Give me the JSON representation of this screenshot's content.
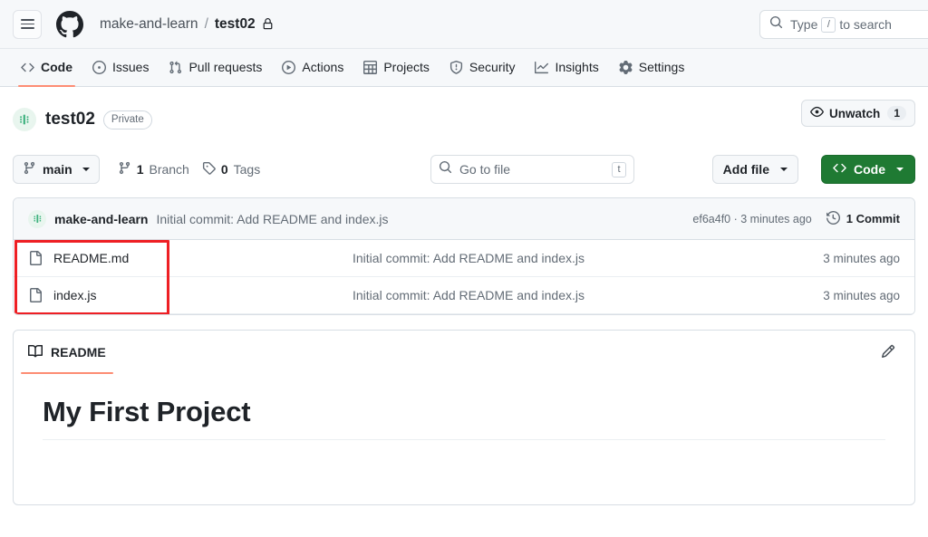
{
  "header": {
    "menu_label": "Open global navigation menu",
    "logo_name": "github-logo",
    "breadcrumb": {
      "owner": "make-and-learn",
      "separator": "/",
      "repo": "test02",
      "lock_icon": "lock-icon"
    },
    "search": {
      "placeholder_prefix": "Type",
      "key_badge": "/",
      "placeholder_suffix": "to search",
      "icon": "search-icon"
    }
  },
  "repo_nav": {
    "items": [
      {
        "label": "Code",
        "icon": "code-icon",
        "active": true
      },
      {
        "label": "Issues",
        "icon": "issue-opened-icon",
        "active": false
      },
      {
        "label": "Pull requests",
        "icon": "git-pull-request-icon",
        "active": false
      },
      {
        "label": "Actions",
        "icon": "play-icon",
        "active": false
      },
      {
        "label": "Projects",
        "icon": "table-icon",
        "active": false
      },
      {
        "label": "Security",
        "icon": "shield-icon",
        "active": false
      },
      {
        "label": "Insights",
        "icon": "graph-icon",
        "active": false
      },
      {
        "label": "Settings",
        "icon": "gear-icon",
        "active": false
      }
    ]
  },
  "repo_header": {
    "avatar": "repo-owner-avatar",
    "title": "test02",
    "visibility": "Private",
    "watch": {
      "label": "Unwatch",
      "count": "1",
      "icon": "eye-icon"
    }
  },
  "file_toolbar": {
    "branch": {
      "name": "main",
      "icon": "git-branch-icon"
    },
    "branch_count": {
      "value": "1",
      "label": "Branch",
      "icon": "git-branch-icon"
    },
    "tag_count": {
      "value": "0",
      "label": "Tags",
      "icon": "tag-icon"
    },
    "go_to_file": {
      "placeholder": "Go to file",
      "key_badge": "t",
      "icon": "search-icon"
    },
    "add_file": {
      "label": "Add file",
      "icon": "chevron-down-icon"
    },
    "code": {
      "label": "Code",
      "icon": "code-icon",
      "color": "#1f7a33"
    }
  },
  "latest_commit": {
    "author": "make-and-learn",
    "message": "Initial commit: Add README and index.js",
    "sha": "ef6a4f0",
    "time": "3 minutes ago",
    "sha_and_time": "ef6a4f0 · 3 minutes ago",
    "commit_count_label": "1 Commit",
    "history_icon": "history-icon"
  },
  "files": [
    {
      "name": "README.md",
      "icon": "file-icon",
      "message": "Initial commit: Add README and index.js",
      "time": "3 minutes ago"
    },
    {
      "name": "index.js",
      "icon": "file-icon",
      "message": "Initial commit: Add README and index.js",
      "time": "3 minutes ago"
    }
  ],
  "annotation": {
    "color": "#ee1f24",
    "label": "red-highlight-box-around-file-names"
  },
  "readme": {
    "tab_label": "README",
    "tab_icon": "book-icon",
    "edit_icon": "pencil-icon",
    "heading": "My First Project"
  }
}
